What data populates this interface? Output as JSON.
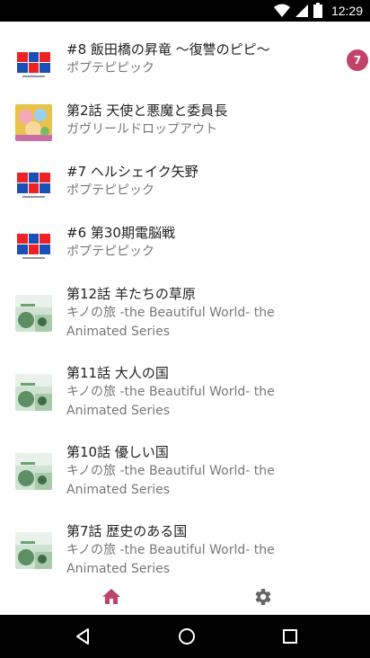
{
  "status_bar": {
    "time": "12:29"
  },
  "items": [
    {
      "title": "#8 飯田橋の昇竜 〜復讐のピピ〜",
      "subtitle": "ポプテピピック",
      "badge": "7",
      "thumb": "popteam"
    },
    {
      "title": "第2話 天使と悪魔と委員長",
      "subtitle": "ガヴリールドロップアウト",
      "badge": "",
      "thumb": "gabriel"
    },
    {
      "title": "#7 ヘルシェイク矢野",
      "subtitle": "ポプテピピック",
      "badge": "",
      "thumb": "popteam"
    },
    {
      "title": "#6 第30期電脳戦",
      "subtitle": "ポプテピピック",
      "badge": "",
      "thumb": "popteam"
    },
    {
      "title": "第12話 羊たちの草原",
      "subtitle": "キノの旅 -the Beautiful World- the Animated Series",
      "badge": "",
      "thumb": "kino"
    },
    {
      "title": "第11話 大人の国",
      "subtitle": "キノの旅 -the Beautiful World- the Animated Series",
      "badge": "",
      "thumb": "kino"
    },
    {
      "title": "第10話 優しい国",
      "subtitle": "キノの旅 -the Beautiful World- the Animated Series",
      "badge": "",
      "thumb": "kino"
    },
    {
      "title": "第7話 歴史のある国",
      "subtitle": "キノの旅 -the Beautiful World- the Animated Series",
      "badge": "",
      "thumb": "kino"
    }
  ],
  "bottom_nav": [
    {
      "icon": "home-icon",
      "active": true
    },
    {
      "icon": "gear-icon",
      "active": false
    }
  ],
  "colors": {
    "accent": "#c2436a",
    "inactive_icon": "#666666"
  }
}
